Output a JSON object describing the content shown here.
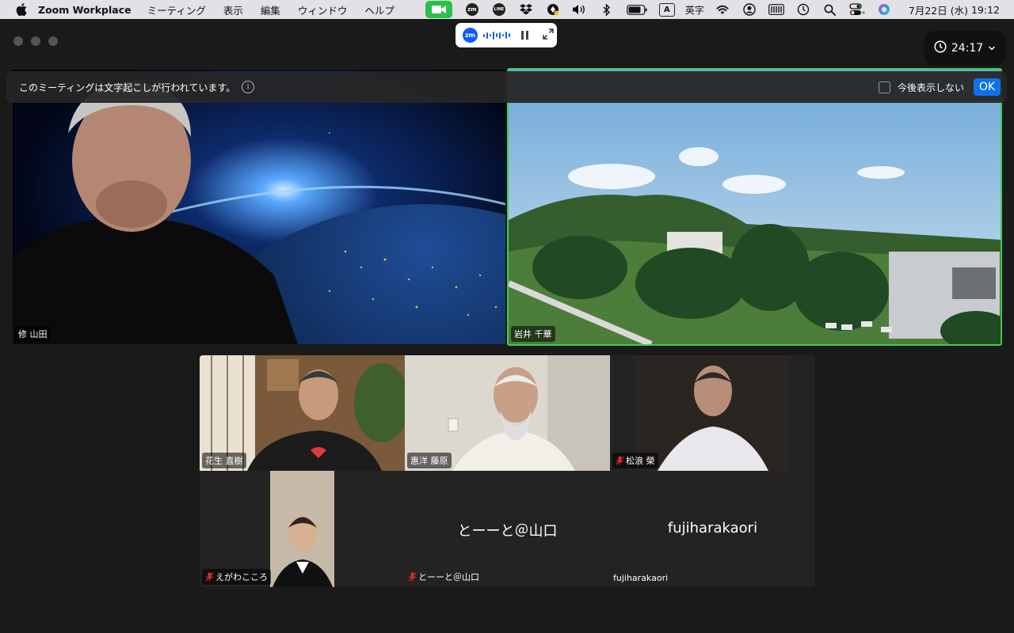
{
  "menubar": {
    "app_name": "Zoom Workplace",
    "items": [
      "ミーティング",
      "表示",
      "編集",
      "ウィンドウ",
      "ヘルプ"
    ],
    "tray": {
      "zm_label": "zm",
      "line_label": "LINE",
      "input_badge": "A",
      "input_label": "英字"
    },
    "date": "7月22日 (水)",
    "time": "19:12"
  },
  "toolbar": {
    "zm_badge": "zm",
    "timer": "24:17"
  },
  "notice": {
    "text": "このミーティングは文字起こしが行われています。",
    "info_glyph": "i",
    "checkbox_label": "今後表示しない",
    "ok_label": "OK"
  },
  "participants": {
    "speaker_left": "修 山田",
    "speaker_right": "岩井 千華",
    "gallery": [
      {
        "name": "花生 直樹",
        "muted": false
      },
      {
        "name": "惠洋 藤原",
        "muted": false
      },
      {
        "name": "松浪 榮",
        "muted": true
      },
      {
        "name": "えがわこころ",
        "muted": true
      },
      {
        "name": "とーーと＠山口",
        "muted": true,
        "display": "とーーと＠山口"
      },
      {
        "name": "fujiharakaori",
        "muted": false,
        "display": "fujiharakaori"
      }
    ]
  },
  "colors": {
    "active_speaker_border": "#3ccf4e",
    "ok_button": "#0e72ed",
    "zoom_blue": "#0b5cff",
    "mute_red": "#e02828"
  }
}
